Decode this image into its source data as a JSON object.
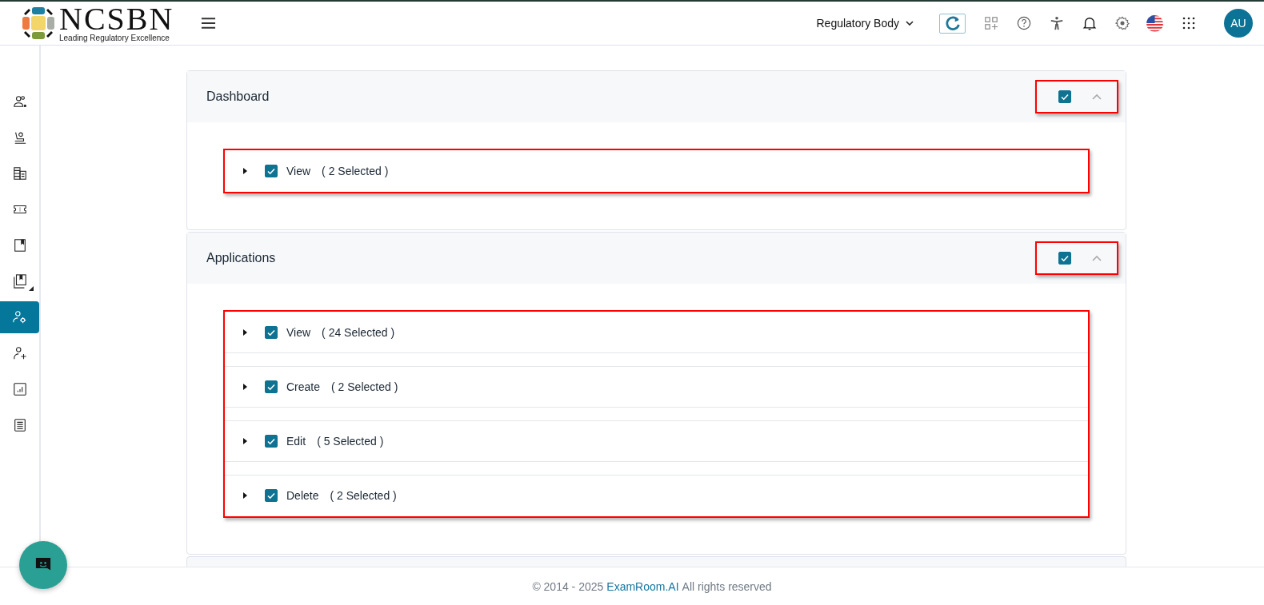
{
  "header": {
    "logo": {
      "name": "NCSBN",
      "tagline": "Leading Regulatory Excellence"
    },
    "role_dropdown": "Regulatory Body",
    "avatar": "AU"
  },
  "sidebar": {
    "items": [
      {
        "selected": false,
        "has_submenu": false
      },
      {
        "selected": false,
        "has_submenu": false
      },
      {
        "selected": false,
        "has_submenu": false
      },
      {
        "selected": false,
        "has_submenu": false
      },
      {
        "selected": false,
        "has_submenu": false
      },
      {
        "selected": false,
        "has_submenu": true
      },
      {
        "selected": true,
        "has_submenu": false
      },
      {
        "selected": false,
        "has_submenu": false
      },
      {
        "selected": false,
        "has_submenu": false
      },
      {
        "selected": false,
        "has_submenu": false
      }
    ]
  },
  "sections": [
    {
      "title": "Dashboard",
      "checked": true,
      "expanded": true,
      "highlighted": true,
      "permissions": [
        {
          "label": "View",
          "count": "( 2 Selected )",
          "checked": true
        }
      ]
    },
    {
      "title": "Applications",
      "checked": true,
      "expanded": true,
      "highlighted": true,
      "permissions": [
        {
          "label": "View",
          "count": "( 24 Selected )",
          "checked": true
        },
        {
          "label": "Create",
          "count": "( 2 Selected )",
          "checked": true
        },
        {
          "label": "Edit",
          "count": "( 5 Selected )",
          "checked": true
        },
        {
          "label": "Delete",
          "count": "( 2 Selected )",
          "checked": true
        }
      ]
    }
  ],
  "footer": {
    "copyright": "© 2014 - 2025",
    "link": "ExamRoom.AI",
    "rights": "All rights reserved"
  }
}
